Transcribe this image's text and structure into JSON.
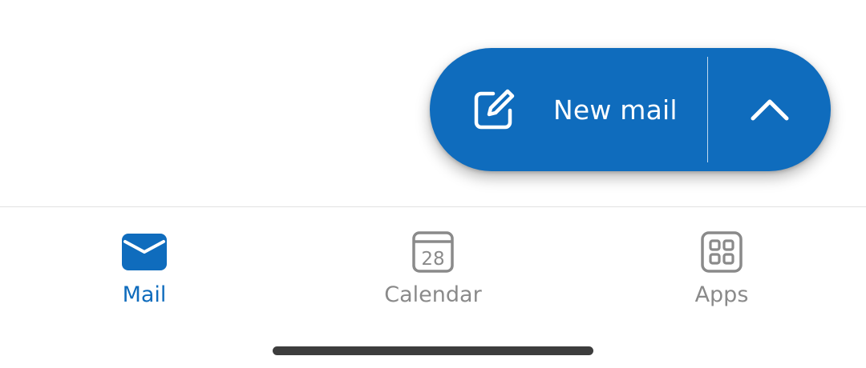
{
  "fab": {
    "label": "New mail",
    "icon": "compose-icon",
    "expand_icon": "chevron-up-icon",
    "color": "#0f6cbd"
  },
  "bottom_nav": {
    "tabs": [
      {
        "label": "Mail",
        "icon": "mail-icon",
        "active": true
      },
      {
        "label": "Calendar",
        "icon": "calendar-icon",
        "badge": "28",
        "active": false
      },
      {
        "label": "Apps",
        "icon": "apps-grid-icon",
        "active": false
      }
    ],
    "active_color": "#0f6cbd",
    "inactive_color": "#8a8a8a"
  }
}
